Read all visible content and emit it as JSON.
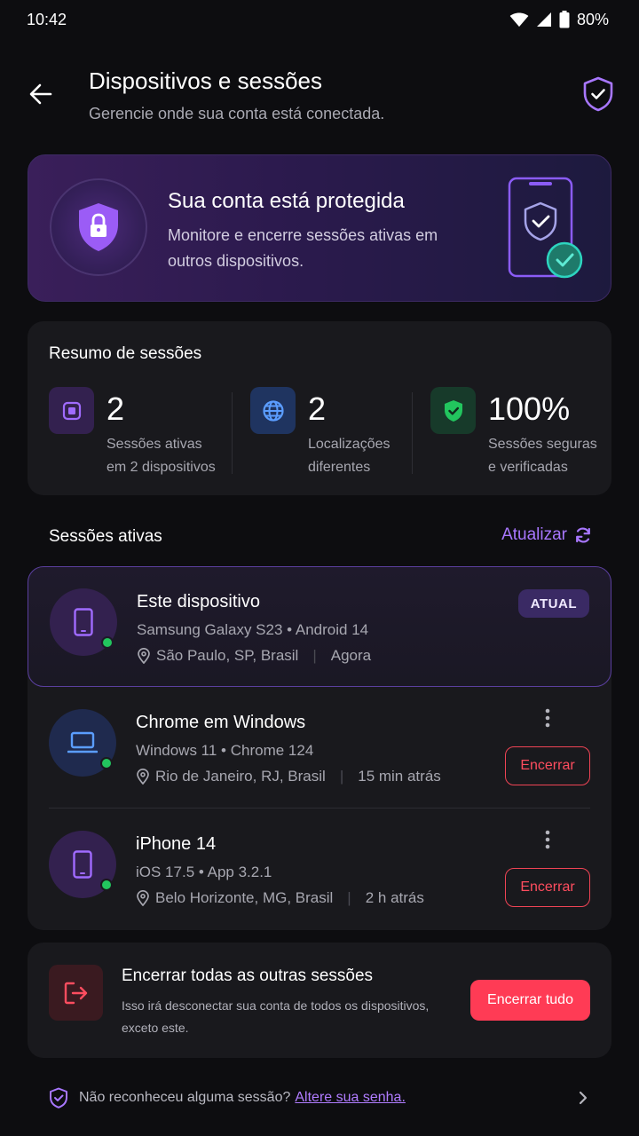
{
  "status_bar": {
    "time": "10:42",
    "battery": "80%"
  },
  "header": {
    "title": "Dispositivos e sessões",
    "subtitle": "Gerencie onde sua conta está conectada."
  },
  "hero": {
    "title": "Sua conta está protegida",
    "text": "Monitore e encerre sessões ativas em outros dispositivos."
  },
  "summary": {
    "title": "Resumo de sessões",
    "stats": [
      {
        "value": "2",
        "label_line1": "Sessões ativas",
        "label_line2": "em 2 dispositivos",
        "icon": "device-icon",
        "color": "#8b5cf6"
      },
      {
        "value": "2",
        "label_line1": "Localizações",
        "label_line2": "diferentes",
        "icon": "globe-icon",
        "color": "#3b82f6"
      },
      {
        "value": "100%",
        "label_line1": "Sessões seguras",
        "label_line2": "e verificadas",
        "icon": "shield-check-icon",
        "color": "#22c55e"
      }
    ]
  },
  "sessions": {
    "title": "Sessões ativas",
    "refresh_label": "Atualizar",
    "items": [
      {
        "name": "Este dispositivo",
        "device": "Samsung Galaxy S23 • Android 14",
        "location": "São Paulo, SP, Brasil",
        "time": "Agora",
        "badge": "ATUAL",
        "icon": "phone-icon"
      },
      {
        "name": "Chrome em Windows",
        "device": "Windows 11 • Chrome 124",
        "location": "Rio de Janeiro, RJ, Brasil",
        "time": "15 min atrás",
        "action": "Encerrar",
        "icon": "laptop-icon"
      },
      {
        "name": "iPhone 14",
        "device": "iOS 17.5 • App 3.2.1",
        "location": "Belo Horizonte, MG, Brasil",
        "time": "2 h atrás",
        "action": "Encerrar",
        "icon": "phone-icon"
      }
    ]
  },
  "end_all": {
    "title": "Encerrar todas as outras sessões",
    "text": "Isso irá desconectar sua conta de todos os dispositivos, exceto este.",
    "button": "Encerrar tudo"
  },
  "footer": {
    "text": "Não reconheceu alguma sessão?",
    "link": "Altere sua senha."
  },
  "colors": {
    "accent": "#a877ff",
    "danger": "#ff3b55",
    "online": "#22c55e",
    "background": "#0d0d10",
    "card": "#19191d"
  }
}
